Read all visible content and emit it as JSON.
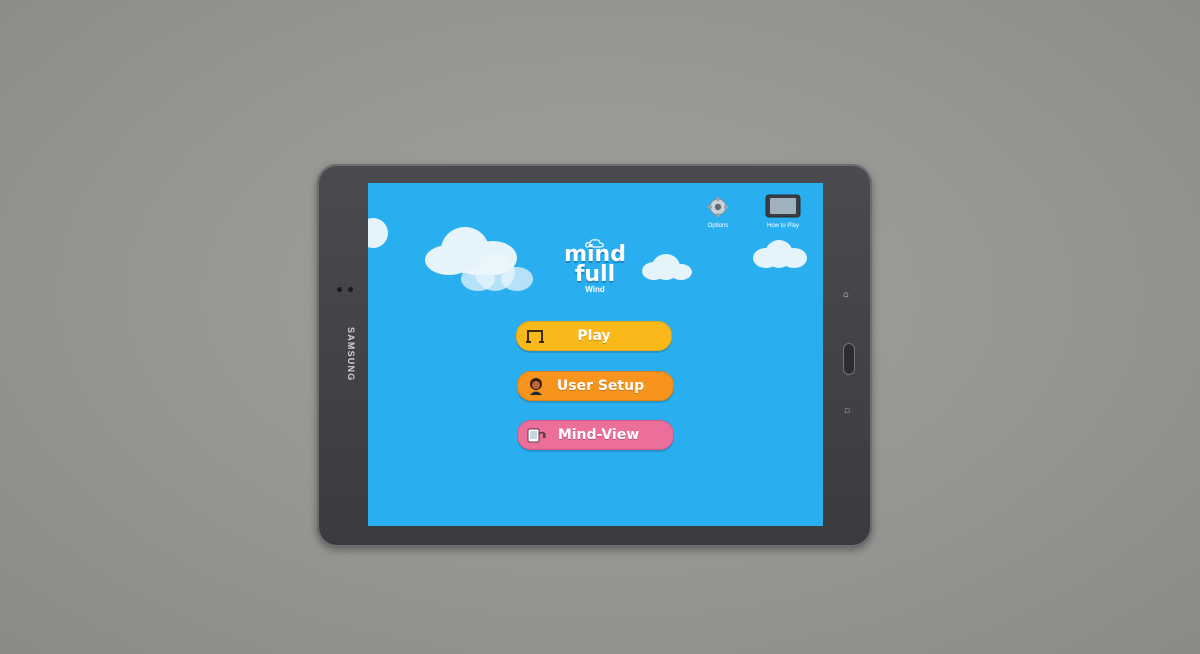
{
  "device": {
    "brand": "SAMSUNG"
  },
  "app": {
    "logo": {
      "line1": "mind",
      "line2": "full",
      "line3": "Wind"
    },
    "top_buttons": [
      {
        "label": "Options",
        "icon": "gear-icon"
      },
      {
        "label": "How to Play",
        "icon": "tablet-icon"
      }
    ],
    "menu": [
      {
        "label": "Play",
        "icon": "goal-icon",
        "color": "#f9b91a"
      },
      {
        "label": "User Setup",
        "icon": "avatar-icon",
        "color": "#f7941d"
      },
      {
        "label": "Mind-View",
        "icon": "headset-tablet-icon",
        "color": "#ec6f9b"
      }
    ]
  },
  "colors": {
    "sky": "#29aff0",
    "cloud": "#e5f3fb",
    "bezel": "#3a3b3f",
    "table": "#979592"
  }
}
